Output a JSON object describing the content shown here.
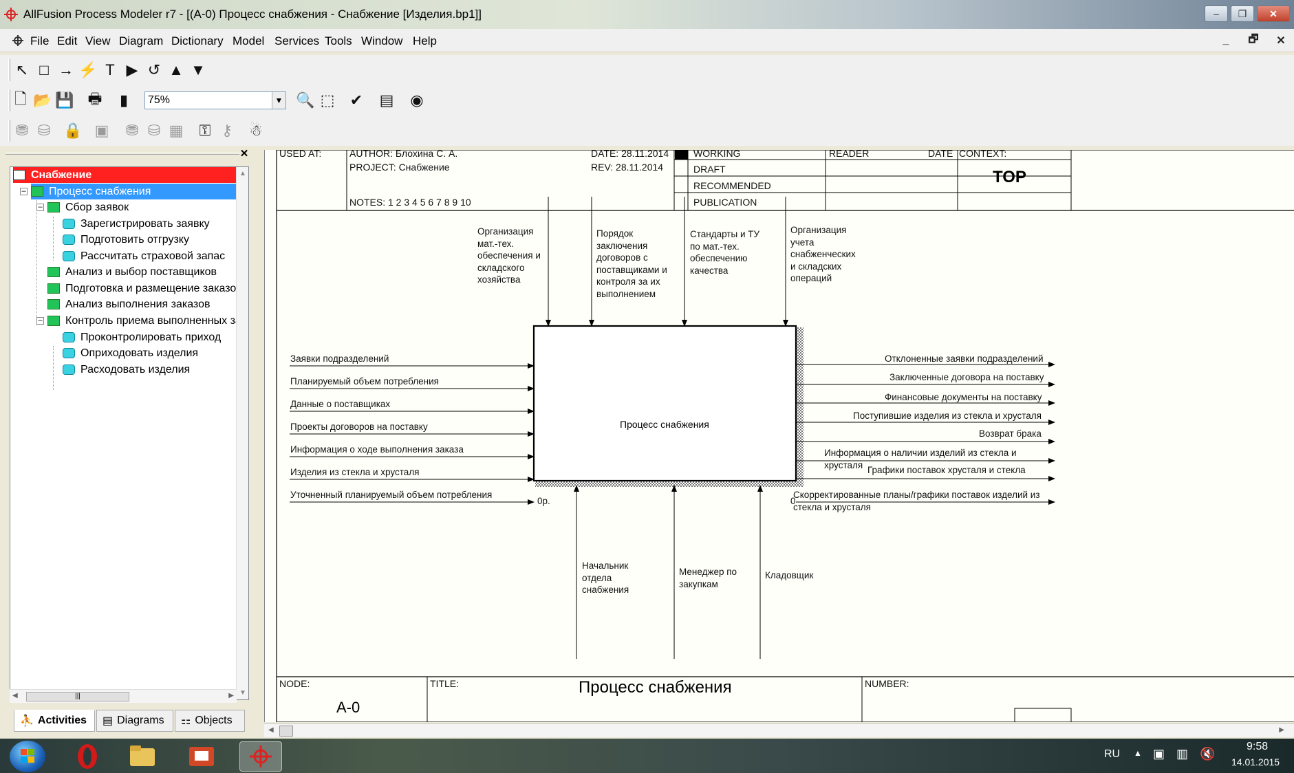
{
  "window": {
    "title": "AllFusion Process Modeler r7 - [(A-0) Процесс снабжения  - Снабжение  [Изделия.bp1]]",
    "controls": [
      "–",
      "❐",
      "✕"
    ]
  },
  "menubar": {
    "items": [
      "File",
      "Edit",
      "View",
      "Diagram",
      "Dictionary",
      "Model",
      "Services",
      "Tools",
      "Window",
      "Help"
    ],
    "mdi_controls": [
      "_",
      "🗗",
      "✕"
    ]
  },
  "toolbar": {
    "zoom_value": "75%"
  },
  "tree": {
    "root": "Снабжение",
    "selected": "Процесс снабжения",
    "groups": [
      "Сбор заявок",
      "Анализ и  выбор поставщиков",
      "Подготовка и размещение заказо",
      "Анализ выполнения  заказов",
      "Контроль приема выполненных за"
    ],
    "sbor_children": [
      "Зарегистрировать заявку",
      "Подготовить отгрузку",
      "Рассчитать  страховой запас"
    ],
    "kontrol_children": [
      "Проконтролировать приход",
      "Оприходовать изделия",
      "Расходовать изделия"
    ],
    "tabs": [
      "Activities",
      "Diagrams",
      "Objects"
    ]
  },
  "diagram_header": {
    "used_at": "USED AT:",
    "author": "AUTHOR:  Блохина С. А.",
    "project": "PROJECT:  Снабжение",
    "date": "DATE: 28.11.2014",
    "rev": "REV:   28.11.2014",
    "notes": "NOTES:  1  2  3  4  5  6  7  8  9  10",
    "status": [
      "WORKING",
      "DRAFT",
      "RECOMMENDED",
      "PUBLICATION"
    ],
    "reader": "READER",
    "date2": "DATE",
    "context": "CONTEXT:",
    "top": "TOP"
  },
  "diagram": {
    "box_label": "Процесс снабжения",
    "box_corner_left": "0р.",
    "box_corner_right": "0",
    "controls": [
      "Организация\nмат.-тех.\nобеспечения и\nскладского\nхозяйства",
      "Порядок\nзаключения\nдоговоров с\nпоставщиками и\nконтроля за их\nвыполнением",
      "Стандарты и ТУ\nпо мат.-тех.\nобеспечению\nкачества",
      "Организация\nучета\nснабженческих\nи складских\nопераций"
    ],
    "inputs": [
      "Заявки подразделений",
      "Планируемый объем потребления",
      "Данные о поставщиках",
      "Проекты договоров на поставку",
      "Информация о ходе выполнения заказа",
      "Изделия из стекла и хрусталя",
      "Уточненный планируемый объем потребления"
    ],
    "outputs": [
      "Отклоненные заявки подразделений",
      "Заключенные договора на поставку",
      "Финансовые документы на поставку",
      "Поступившие изделия из стекла и хрусталя",
      "Возврат брака",
      "Информация о наличии изделий из стекла и\nхрусталя",
      "Графики поставок хрусталя и стекла",
      "Скорректированные планы/графики поставок изделий из\nстекла и хрусталя"
    ],
    "mechanisms": [
      "Начальник\nотдела\nснабжения",
      "Менеджер по\nзакупкам",
      "Кладовщик"
    ]
  },
  "footer": {
    "node_label": "NODE:",
    "node_value": "A-0",
    "title_label": "TITLE:",
    "title_value": "Процесс снабжения",
    "number_label": "NUMBER:"
  },
  "taskbar": {
    "lang": "RU",
    "time": "9:58",
    "date": "14.01.2015"
  }
}
